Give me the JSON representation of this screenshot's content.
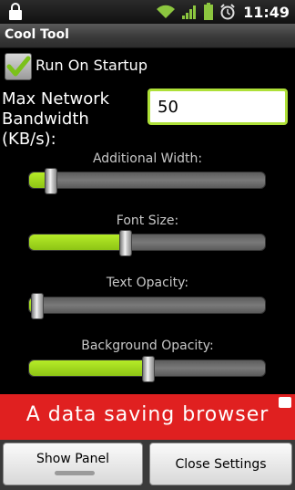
{
  "status_bar": {
    "time": "11:49",
    "icons": [
      "lock-icon",
      "wifi-icon",
      "signal-icon",
      "battery-icon",
      "alarm-icon"
    ]
  },
  "app": {
    "title": "Cool Tool"
  },
  "startup": {
    "label": "Run On Startup",
    "checked": true
  },
  "bandwidth": {
    "label": "Max Network Bandwidth (KB/s):",
    "value": "50"
  },
  "sliders": [
    {
      "label": "Additional Width:",
      "fraction": 0.09
    },
    {
      "label": "Font Size:",
      "fraction": 0.405
    },
    {
      "label": "Text Opacity:",
      "fraction": 0.03
    },
    {
      "label": "Background Opacity:",
      "fraction": 0.5
    }
  ],
  "ad": {
    "text": "A data saving browser"
  },
  "buttons": {
    "show_panel": "Show Panel",
    "close_settings": "Close Settings"
  },
  "colors": {
    "accent": "#a3dc20",
    "ad_background": "#e02020"
  }
}
